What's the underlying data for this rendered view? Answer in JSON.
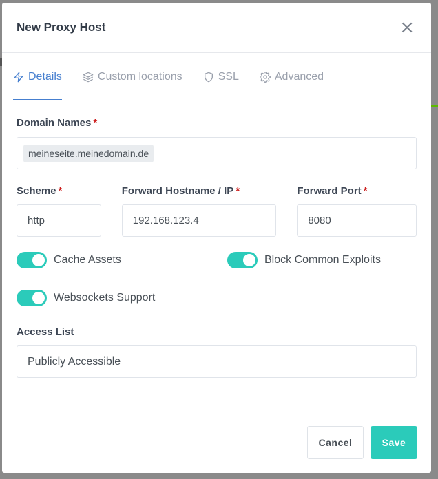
{
  "modal": {
    "title": "New Proxy Host",
    "close_glyph": "×"
  },
  "tabs": [
    {
      "label": "Details",
      "icon": "zap-icon",
      "active": true
    },
    {
      "label": "Custom locations",
      "icon": "layers-icon",
      "active": false
    },
    {
      "label": "SSL",
      "icon": "shield-icon",
      "active": false
    },
    {
      "label": "Advanced",
      "icon": "gear-icon",
      "active": false
    }
  ],
  "form": {
    "domain_names": {
      "label": "Domain Names",
      "required_mark": "*",
      "tags": [
        "meineseite.meinedomain.de"
      ]
    },
    "scheme": {
      "label": "Scheme",
      "required_mark": "*",
      "value": "http"
    },
    "forward_host": {
      "label": "Forward Hostname / IP",
      "required_mark": "*",
      "value": "192.168.123.4"
    },
    "forward_port": {
      "label": "Forward Port",
      "required_mark": "*",
      "value": "8080"
    },
    "toggles": {
      "cache_assets": {
        "label": "Cache Assets",
        "on": true
      },
      "block_exploits": {
        "label": "Block Common Exploits",
        "on": true
      },
      "websockets": {
        "label": "Websockets Support",
        "on": true
      }
    },
    "access_list": {
      "label": "Access List",
      "value": "Publicly Accessible"
    }
  },
  "footer": {
    "cancel_label": "Cancel",
    "save_label": "Save"
  },
  "colors": {
    "accent": "#467fcf",
    "toggle_on": "#2bcbba",
    "required": "#cd201f"
  }
}
